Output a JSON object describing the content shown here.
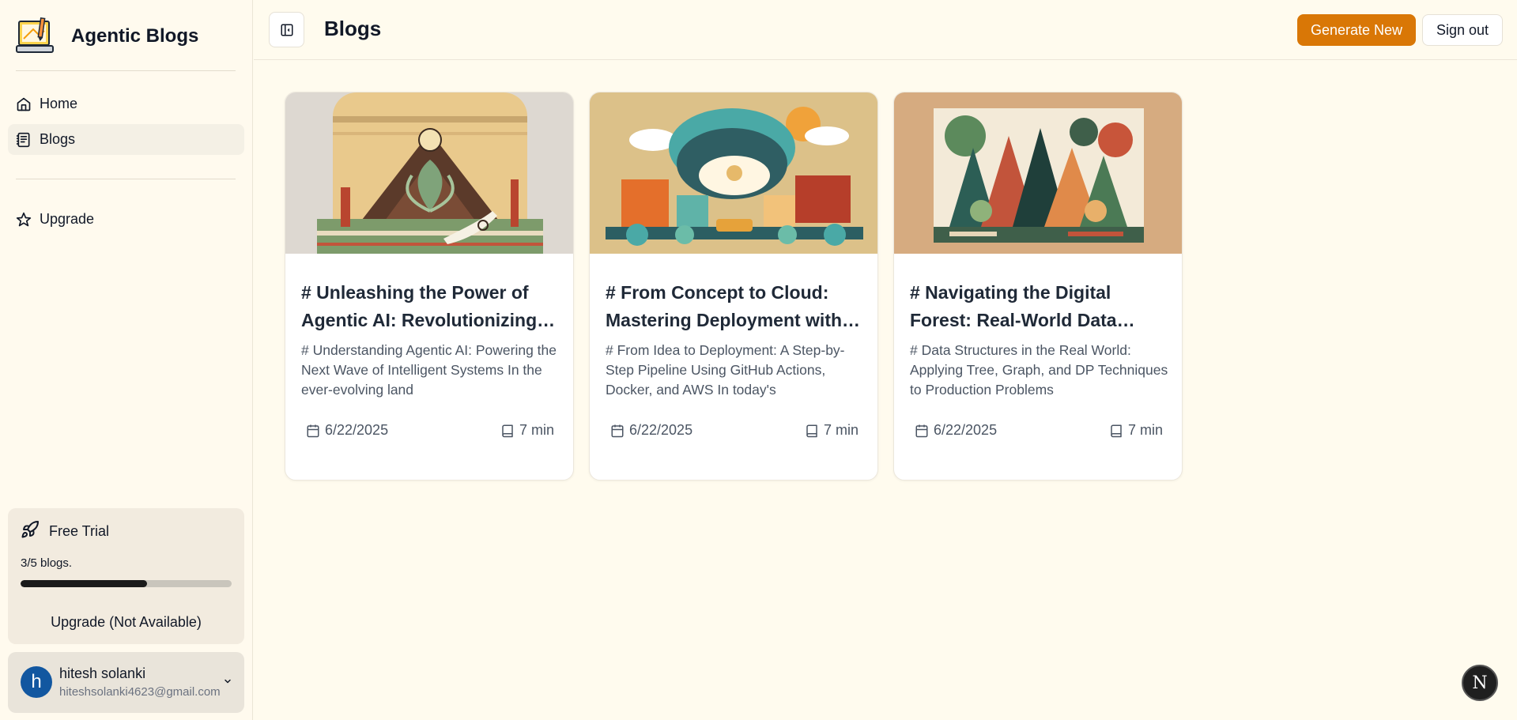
{
  "app": {
    "name": "Agentic Blogs"
  },
  "sidebar": {
    "items": [
      {
        "label": "Home",
        "icon": "home-icon"
      },
      {
        "label": "Blogs",
        "icon": "blogs-icon",
        "active": true
      },
      {
        "label": "Upgrade",
        "icon": "star-icon"
      }
    ],
    "trial": {
      "title": "Free Trial",
      "count_text": "3/5 blogs.",
      "progress": 0.6,
      "upgrade_label": "Upgrade (Not Available)"
    },
    "user": {
      "initial": "h",
      "name": "hitesh solanki",
      "email": "hiteshsolanki4623@gmail.com"
    }
  },
  "header": {
    "title": "Blogs",
    "generate_label": "Generate New",
    "signout_label": "Sign out"
  },
  "blogs": [
    {
      "title": "# Unleashing the Power of Agentic AI: Revolutionizing Industries",
      "excerpt": "# Understanding Agentic AI: Powering the Next Wave of Intelligent Systems In the ever-evolving land",
      "date": "6/22/2025",
      "read_time": "7 min"
    },
    {
      "title": "# From Concept to Cloud: Mastering Deployment with CI/CD",
      "excerpt": "# From Idea to Deployment: A Step-by-Step Pipeline Using GitHub Actions, Docker, and AWS In today's",
      "date": "6/22/2025",
      "read_time": "7 min"
    },
    {
      "title": "# Navigating the Digital Forest: Real-World Data Structures",
      "excerpt": "# Data Structures in the Real World: Applying Tree, Graph, and DP Techniques to Production Problems",
      "date": "6/22/2025",
      "read_time": "7 min"
    }
  ],
  "dev_badge": {
    "label": "N"
  },
  "colors": {
    "accent": "#d97706",
    "background": "#fffbee",
    "avatar": "#1257a0"
  }
}
